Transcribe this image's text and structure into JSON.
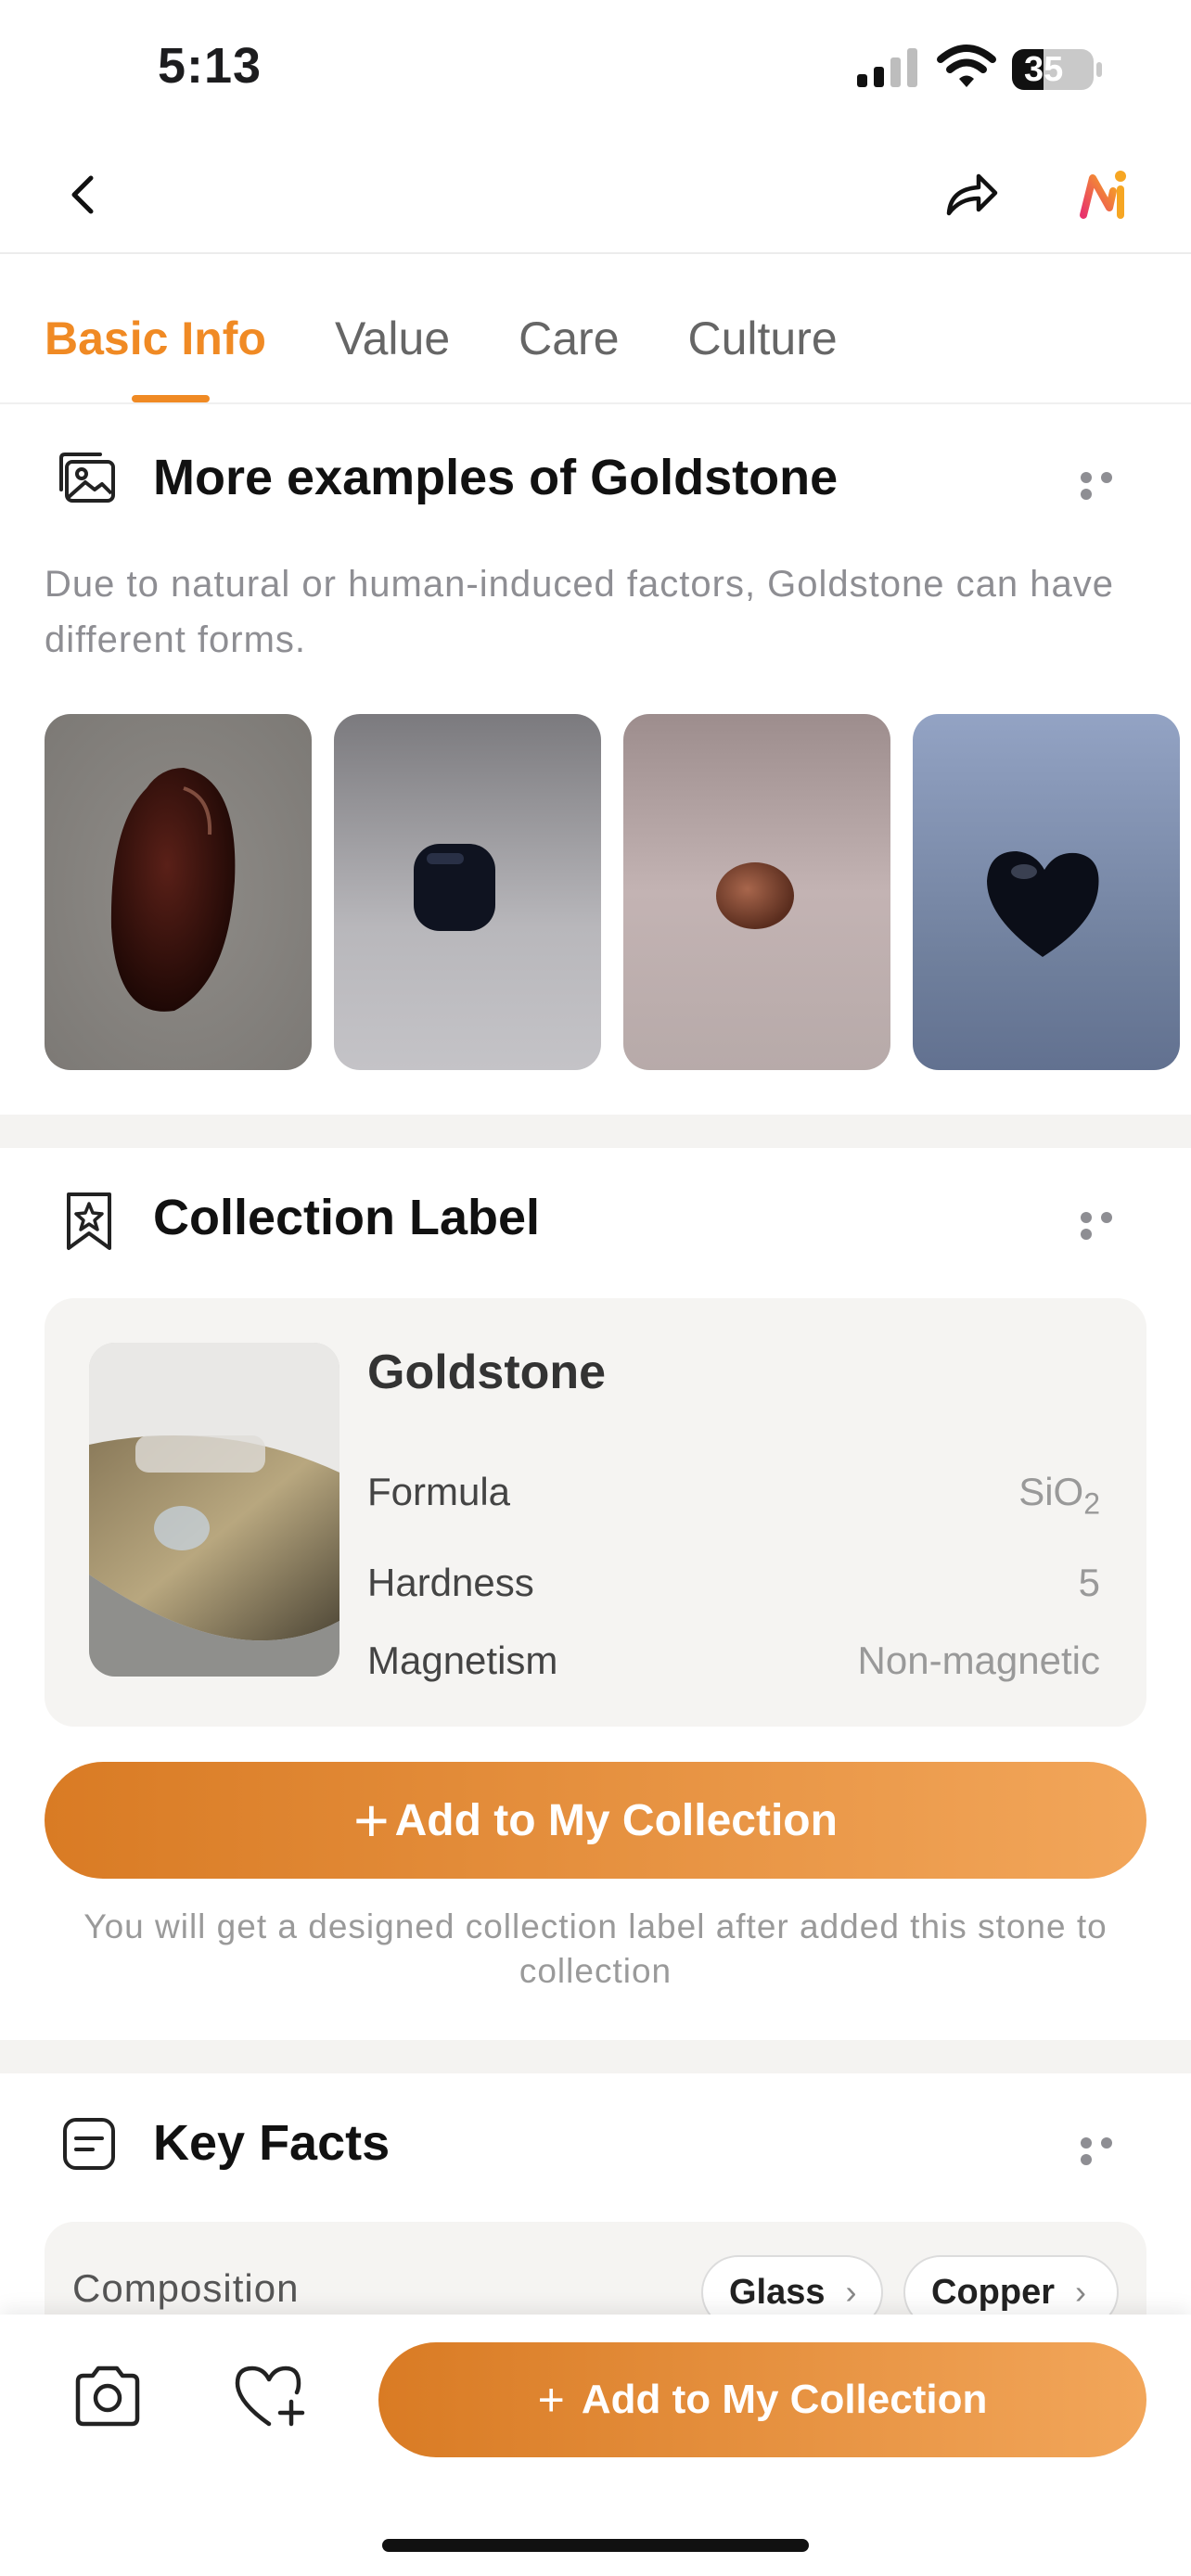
{
  "status_bar": {
    "time": "5:13",
    "battery": "35"
  },
  "tabs": [
    {
      "label": "Basic Info",
      "active": true
    },
    {
      "label": "Value",
      "active": false
    },
    {
      "label": "Care",
      "active": false
    },
    {
      "label": "Culture",
      "active": false
    }
  ],
  "examples": {
    "title": "More examples of Goldstone",
    "subtitle": "Due to natural or human-induced factors, Goldstone can have different forms.",
    "images": [
      "dark red oval goldstone",
      "dark blue cube goldstone",
      "brown round goldstone",
      "blue heart goldstone"
    ]
  },
  "collection_label": {
    "title": "Collection Label",
    "name": "Goldstone",
    "rows": [
      {
        "label": "Formula",
        "value": "SiO",
        "sub": "2"
      },
      {
        "label": "Hardness",
        "value": "5"
      },
      {
        "label": "Magnetism",
        "value": "Non-magnetic"
      }
    ],
    "button_label": "Add to My Collection",
    "hint": "You will get a designed collection label after added this stone to collection"
  },
  "key_facts": {
    "title": "Key Facts",
    "composition_label": "Composition",
    "chips": [
      "Glass",
      "Copper"
    ]
  },
  "bottom_bar": {
    "button_label": "Add to My Collection"
  },
  "colors": {
    "accent": "#f08a24",
    "button_start": "#d97b24",
    "button_end": "#f2a65a"
  }
}
